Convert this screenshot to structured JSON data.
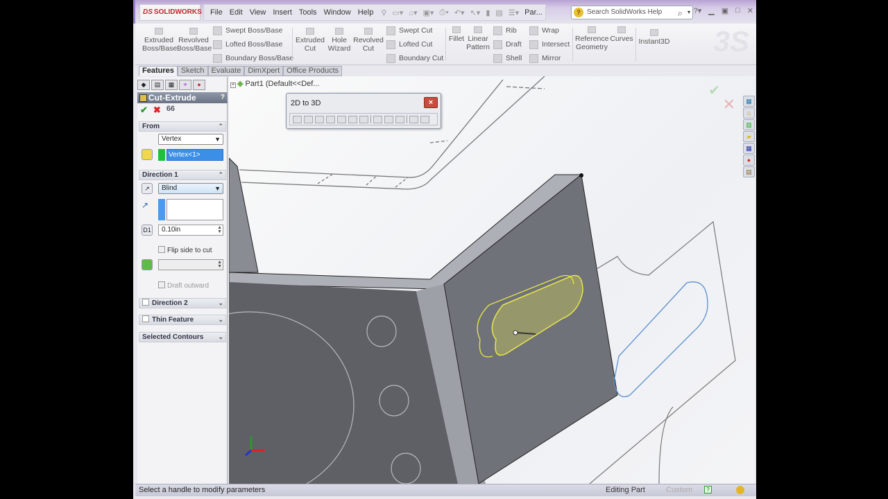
{
  "app": {
    "name": "SOLIDWORKS",
    "doc_title": "Par...",
    "search_placeholder": "Search SolidWorks Help"
  },
  "menu": [
    "File",
    "Edit",
    "View",
    "Insert",
    "Tools",
    "Window",
    "Help"
  ],
  "ribbon": {
    "extruded_boss": "Extruded Boss/Base",
    "revolved_boss": "Revolved Boss/Base",
    "swept_boss": "Swept Boss/Base",
    "lofted_boss": "Lofted Boss/Base",
    "boundary_boss": "Boundary Boss/Base",
    "extruded_cut": "Extruded Cut",
    "hole_wizard": "Hole Wizard",
    "revolved_cut": "Revolved Cut",
    "swept_cut": "Swept Cut",
    "lofted_cut": "Lofted Cut",
    "boundary_cut": "Boundary Cut",
    "fillet": "Fillet",
    "linear_pattern": "Linear Pattern",
    "rib": "Rib",
    "draft": "Draft",
    "shell": "Shell",
    "wrap": "Wrap",
    "intersect": "Intersect",
    "mirror": "Mirror",
    "reference_geometry": "Reference Geometry",
    "curves": "Curves",
    "instant3d": "Instant3D"
  },
  "command_tabs": [
    "Features",
    "Sketch",
    "Evaluate",
    "DimXpert",
    "Office Products"
  ],
  "active_tab": "Features",
  "tree": {
    "root": "Part1  (Default<<Def..."
  },
  "toolbar_2d3d": {
    "title": "2D to 3D",
    "close": "×"
  },
  "property_manager": {
    "title": "Cut-Extrude",
    "help": "?",
    "from": {
      "label": "From",
      "type": "Vertex",
      "selection": "Vertex<1>"
    },
    "direction1": {
      "label": "Direction 1",
      "end_condition": "Blind",
      "depth": "0.10in",
      "flip_side": "Flip side to cut",
      "draft_outward": "Draft outward"
    },
    "direction2": {
      "label": "Direction 2"
    },
    "thin_feature": {
      "label": "Thin Feature"
    },
    "selected_contours": {
      "label": "Selected Contours"
    }
  },
  "status": {
    "message": "Select a handle to modify parameters",
    "mode": "Editing Part",
    "units": "Custom",
    "help": "?"
  },
  "colors": {
    "accent_selection": "#3b8fe6",
    "preview": "#e8e84a",
    "model_face": "#6b6d76"
  }
}
